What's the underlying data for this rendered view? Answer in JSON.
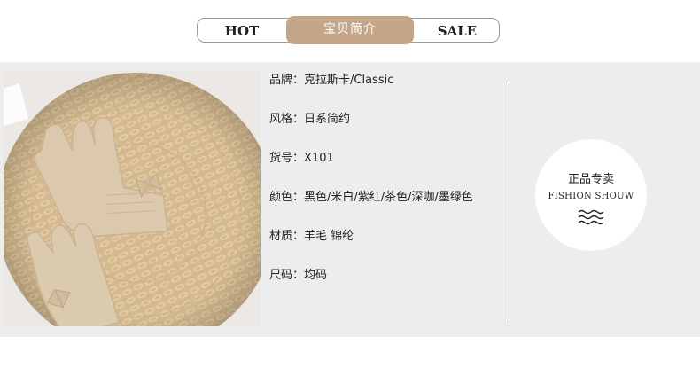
{
  "header": {
    "tab_left": "HOT",
    "tab_center": "宝贝简介",
    "tab_right": "SALE"
  },
  "product": {
    "image_alt": "米色羊毛手套放在编织草垫上",
    "specs": [
      {
        "label": "品牌：",
        "value": "克拉斯卡/Classic"
      },
      {
        "label": "风格：",
        "value": "日系简约"
      },
      {
        "label": "货号：",
        "value": "X101"
      },
      {
        "label": "颜色：",
        "value": "黑色/米白/紫红/茶色/深咖/墨绿色"
      },
      {
        "label": "材质：",
        "value": "羊毛 锦纶"
      },
      {
        "label": "尺码：",
        "value": "均码"
      }
    ]
  },
  "badge": {
    "title": "正品专卖",
    "subtitle": "FISHION SHOUW",
    "icon": "waves-icon"
  },
  "colors": {
    "accent": "#c5a588",
    "panel_bg": "#ededed",
    "glove": "#dcc8ad"
  }
}
